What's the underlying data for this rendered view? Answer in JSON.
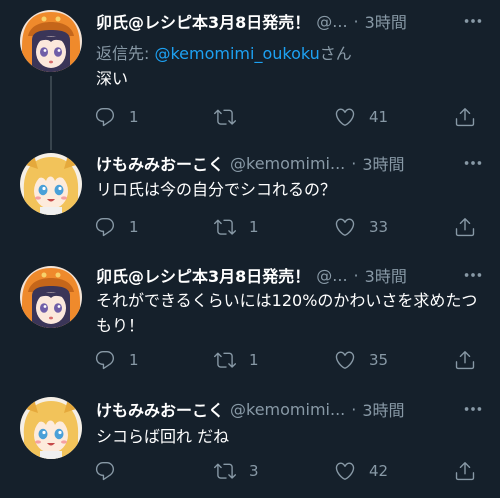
{
  "tweets": [
    {
      "name": "卯氏@レシピ本3月8日発売！",
      "handle": "@...",
      "dot": "·",
      "time": "3時間",
      "reply_prefix": "返信先: ",
      "reply_handle": "@kemomimi_oukoku",
      "reply_suffix": "さん",
      "text": "深い",
      "replies": "1",
      "retweets": "",
      "likes": "41",
      "avatar": "hooded-girl"
    },
    {
      "name": "けもみみおーこく",
      "handle": "@kemomimi...",
      "dot": "·",
      "time": "3時間",
      "text": "リロ氏は今の自分でシコれるの？",
      "replies": "1",
      "retweets": "1",
      "likes": "33",
      "avatar": "blonde-girl"
    },
    {
      "name": "卯氏@レシピ本3月8日発売！",
      "handle": "@...",
      "dot": "·",
      "time": "3時間",
      "text": "それができるくらいには120%のかわいさを求めたつもり！",
      "replies": "1",
      "retweets": "1",
      "likes": "35",
      "avatar": "hooded-girl"
    },
    {
      "name": "けもみみおーこく",
      "handle": "@kemomimi...",
      "dot": "·",
      "time": "3時間",
      "text": "シコらば回れ だね",
      "replies": "",
      "retweets": "3",
      "likes": "42",
      "avatar": "blonde-girl"
    }
  ],
  "icons": {
    "reply": "reply-icon",
    "retweet": "retweet-icon",
    "like": "heart-icon",
    "share": "share-icon",
    "more": "more-icon"
  },
  "colors": {
    "background": "#15202b",
    "secondary_text": "#8899a6",
    "link": "#1da1f2",
    "thread_line": "#38444d",
    "avatar_orange": "#ef8a2c",
    "avatar_blonde": "#f2c35a"
  }
}
